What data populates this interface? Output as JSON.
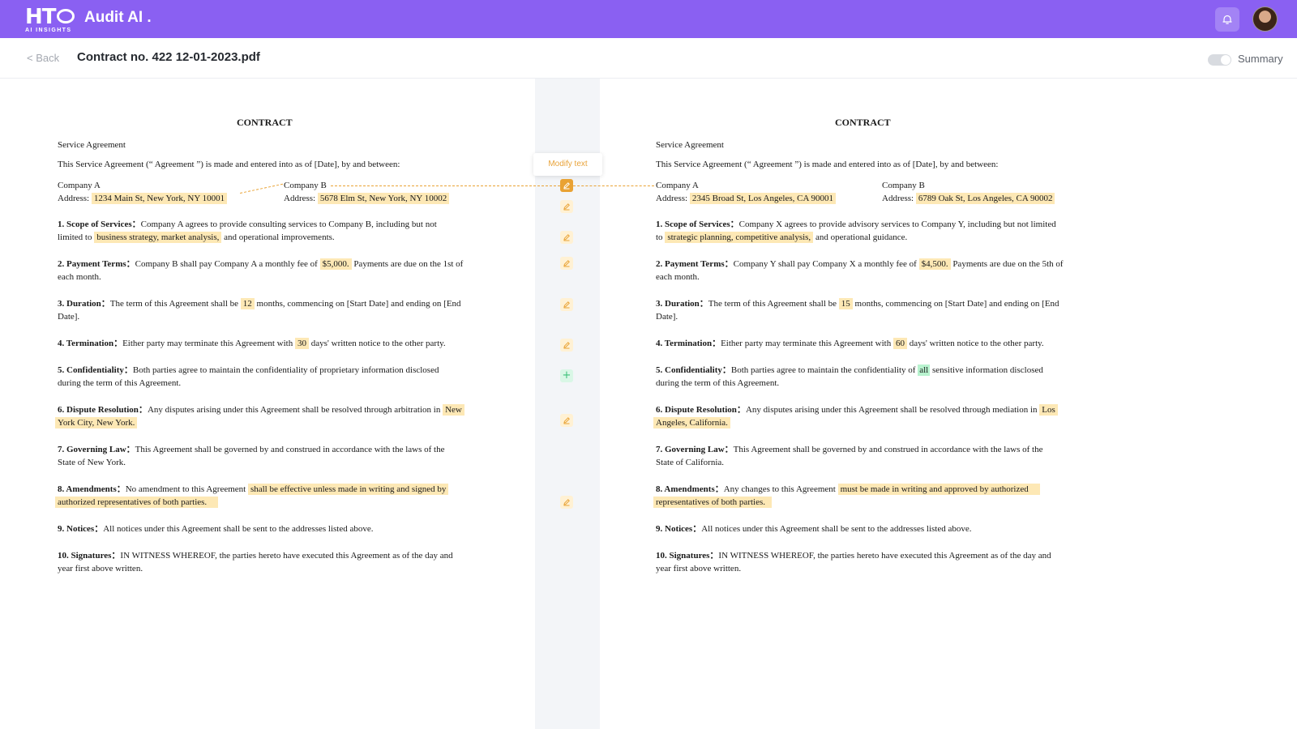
{
  "header": {
    "logo_text": "HT",
    "logo_sub": "AI INSIGHTS",
    "app_title": "Audit AI .",
    "bell_icon": "bell-icon",
    "avatar_icon": "user-avatar"
  },
  "subheader": {
    "back_label": "< Back",
    "file_title": "Contract no. 422 12-01-2023.pdf",
    "summary_label": "Summary",
    "summary_toggle_on": false
  },
  "compare": {
    "tooltip": "Modify text",
    "icons": [
      "edit-icon",
      "add-icon"
    ]
  },
  "colors": {
    "brand": "#8a60f2",
    "highlight": "#fde8b5",
    "highlight_added": "#b8f3cf",
    "accent_orange": "#e9a234"
  },
  "left_doc": {
    "title": "CONTRACT",
    "subtitle": "Service Agreement",
    "intro": "This Service Agreement (“ Agreement ”) is made and entered into as of [Date], by and between:",
    "company_a": "Company A",
    "company_a_address_label": "Address:",
    "company_a_address": "1234 Main St, New York, NY 10001",
    "company_b": "Company B",
    "company_b_address_label": "Address:",
    "company_b_address": "5678 Elm St, New York, NY 10002",
    "s1_label": "1. Scope of Services：",
    "s1_a": "Company A agrees to provide consulting services to Company B, including but not",
    "s1_b": "limited to",
    "s1_hl": "business strategy, market analysis,",
    "s1_c": "and operational improvements.",
    "s2_label": "2. Payment Terms：",
    "s2_a": "Company B shall pay Company A a monthly fee of",
    "s2_hl": "$5,000.",
    "s2_b": "Payments are due on the 1st of",
    "s2_c": "each month.",
    "s3_label": "3. Duration：",
    "s3_a": "The term of this Agreement shall be",
    "s3_hl": "12",
    "s3_b": "months, commencing on [Start Date] and ending on [End",
    "s3_c": "Date].",
    "s4_label": "4. Termination：",
    "s4_a": "Either party may terminate this Agreement with",
    "s4_hl": "30",
    "s4_b": "days' written notice to the other party.",
    "s5_label": "5. Confidentiality：",
    "s5_a": "Both parties agree to maintain the confidentiality of proprietary information disclosed",
    "s5_b": "during the term of this Agreement.",
    "s6_label": "6. Dispute Resolution：",
    "s6_a": "Any disputes arising under this Agreement shall be resolved through arbitration in",
    "s6_hl1": "New",
    "s6_hl2": "York City, New York.",
    "s7_label": "7. Governing Law：",
    "s7_a": "This Agreement shall be governed by and construed in accordance with the laws of the",
    "s7_b": "State of New York.",
    "s8_label": "8. Amendments：",
    "s8_a": "No amendment to this Agreement",
    "s8_hl1": "shall be effective unless made in writing and signed by",
    "s8_hl2": "authorized representatives of both parties.",
    "s9_label": "9. Notices：",
    "s9_a": "All notices under this Agreement shall be sent to the addresses listed above.",
    "s10_label": "10. Signatures：",
    "s10_a": "IN WITNESS WHEREOF, the parties hereto have executed this Agreement as of the day and",
    "s10_b": "year first above written."
  },
  "right_doc": {
    "title": "CONTRACT",
    "subtitle": "Service Agreement",
    "intro": "This Service Agreement (“ Agreement ”) is made and entered into as of [Date], by and between:",
    "company_a": "Company A",
    "company_a_address_label": "Address:",
    "company_a_address": "2345 Broad St, Los Angeles, CA 90001",
    "company_b": "Company B",
    "company_b_address_label": "Address:",
    "company_b_address": "6789 Oak St, Los Angeles, CA 90002",
    "s1_label": "1. Scope of Services：",
    "s1_a": "Company X agrees to provide advisory services to Company Y, including but not limited",
    "s1_b": "to",
    "s1_hl": "strategic planning, competitive analysis,",
    "s1_c": "and operational guidance.",
    "s2_label": "2. Payment Terms：",
    "s2_a": "Company Y shall pay Company X a monthly fee of",
    "s2_hl": "$4,500.",
    "s2_b": "Payments are due on the 5th of",
    "s2_c": "each month.",
    "s3_label": "3. Duration：",
    "s3_a": "The term of this Agreement shall be",
    "s3_hl": "15",
    "s3_b": "months, commencing on [Start Date] and ending on [End",
    "s3_c": "Date].",
    "s4_label": "4. Termination：",
    "s4_a": "Either party may terminate this Agreement with",
    "s4_hl": "60",
    "s4_b": "days' written notice to the other party.",
    "s5_label": "5. Confidentiality：",
    "s5_a": "Both parties agree to maintain the confidentiality of",
    "s5_hl": "all",
    "s5_b": "sensitive information disclosed",
    "s5_c": "during the term of this Agreement.",
    "s6_label": "6. Dispute Resolution：",
    "s6_a": "Any disputes arising under this Agreement shall be resolved through mediation in",
    "s6_hl1": "Los",
    "s6_hl2": "Angeles, California.",
    "s7_label": "7. Governing Law：",
    "s7_a": "This Agreement shall be governed by and construed in accordance with the laws of the",
    "s7_b": "State of California.",
    "s8_label": "8. Amendments：",
    "s8_a": "Any changes to this Agreement",
    "s8_hl1": "must be made in writing and approved by authorized",
    "s8_hl2": "representatives of both parties.",
    "s9_label": "9. Notices：",
    "s9_a": "All notices under this Agreement shall be sent to the addresses listed above.",
    "s10_label": "10. Signatures：",
    "s10_a": "IN WITNESS WHEREOF, the parties hereto have executed this Agreement as of the day and",
    "s10_b": "year first above written."
  }
}
